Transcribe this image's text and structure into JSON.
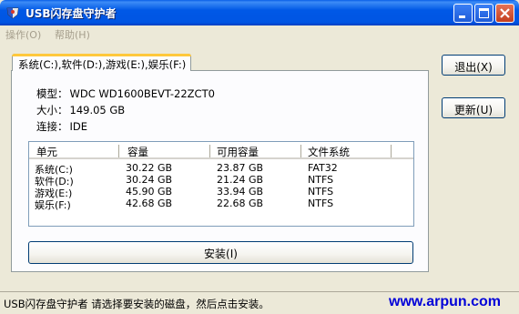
{
  "window": {
    "title": "USB闪存盘守护者"
  },
  "menu": [
    {
      "label": "操作(O)"
    },
    {
      "label": "帮助(H)"
    }
  ],
  "tab": {
    "label": "系统(C:),软件(D:),游戏(E:),娱乐(F:)"
  },
  "drive_info": {
    "model_label": "模型：",
    "model": "WDC WD1600BEVT-22ZCT0",
    "size_label": "大小：",
    "size": "149.05 GB",
    "interface_label": "连接：",
    "interface": "IDE"
  },
  "partitions": {
    "headers": [
      "单元",
      "容量",
      "可用容量",
      "文件系统"
    ],
    "rows": [
      [
        "系统(C:)",
        "30.22 GB",
        "23.87 GB",
        "FAT32"
      ],
      [
        "软件(D:)",
        "30.24 GB",
        "21.24 GB",
        "NTFS"
      ],
      [
        "游戏(E:)",
        "45.90 GB",
        "33.94 GB",
        "NTFS"
      ],
      [
        "娱乐(F:)",
        "42.68 GB",
        "22.68 GB",
        "NTFS"
      ]
    ]
  },
  "buttons": {
    "exit": "退出(X)",
    "refresh": "更新(U)",
    "install": "安装(I)"
  },
  "status": {
    "text": "USB闪存盘守护者  请选择要安装的磁盘，然后点击安装。",
    "watermark": "www.arpun.com"
  },
  "icons": {
    "app": "usb-guard-icon",
    "minimize": "minimize-icon",
    "maximize": "maximize-icon",
    "close": "close-icon"
  },
  "colors": {
    "titlebar": "#0058E6",
    "watermark": "#0000D8",
    "tab_accent": "#FFC83C"
  }
}
